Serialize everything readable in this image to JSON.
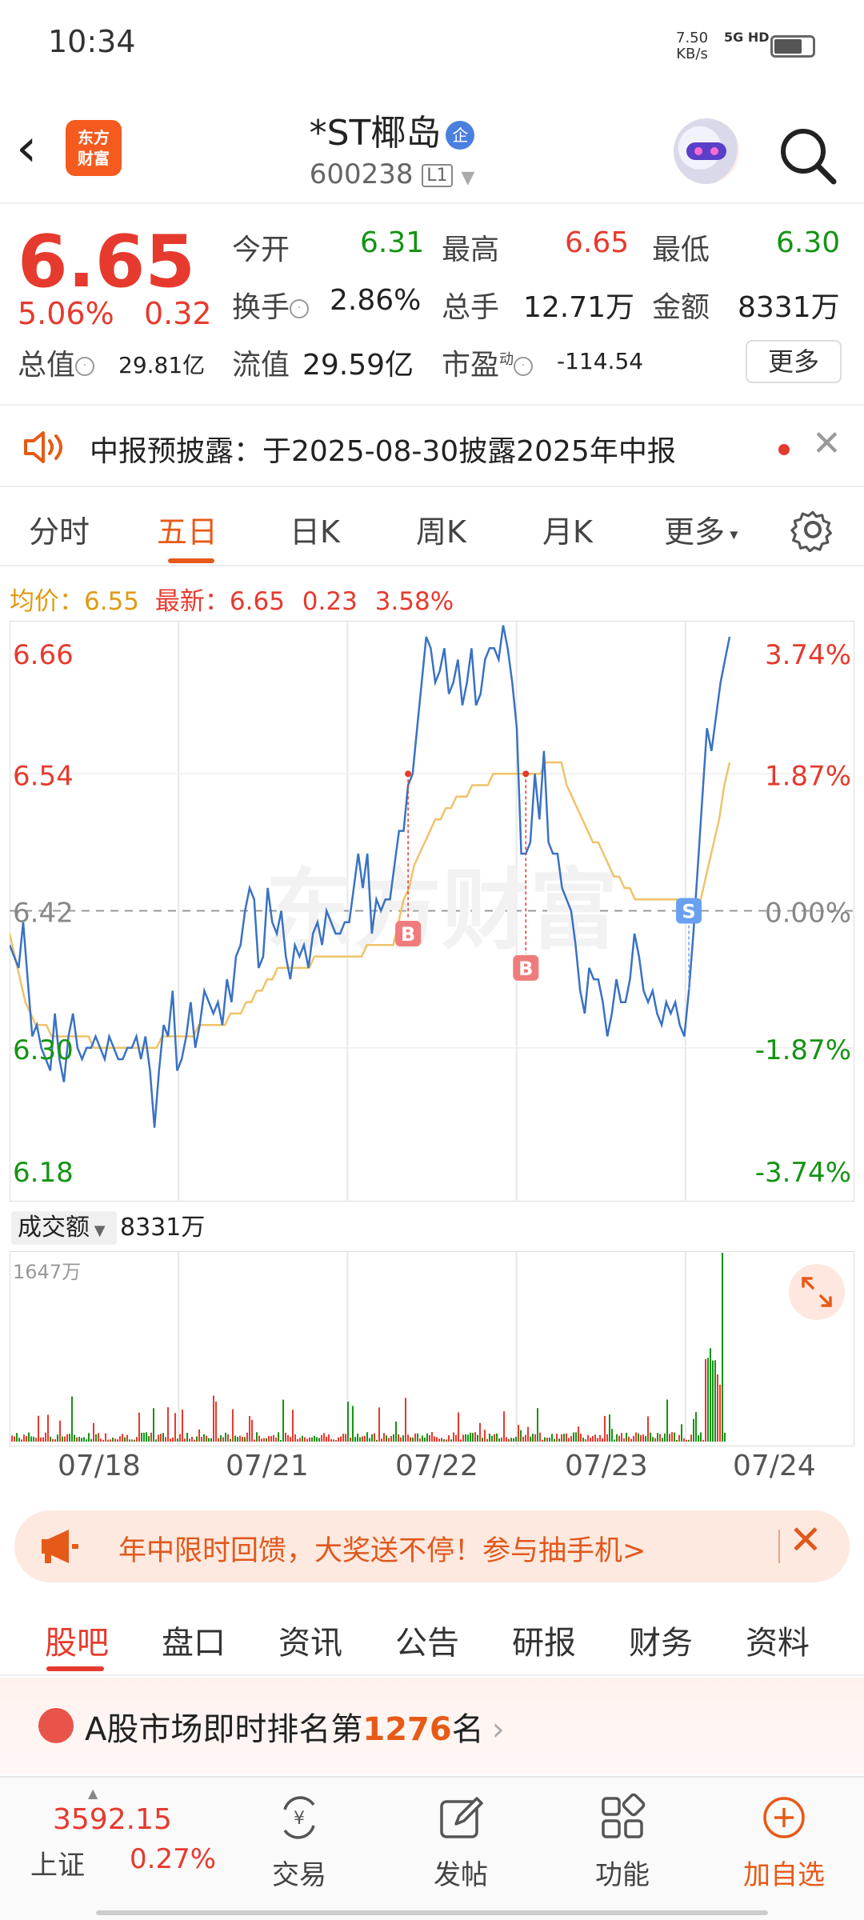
{
  "status_bar": {
    "time": "10:34",
    "net_speed": "7.50",
    "net_unit": "KB/s",
    "signal": "5G HD"
  },
  "header": {
    "logo_line1": "东方",
    "logo_line2": "财富",
    "stock_name": "*ST椰岛",
    "cert_badge": "企",
    "stock_code": "600238",
    "level": "L1"
  },
  "quote": {
    "price": "6.65",
    "change_pct": "5.06%",
    "change_val": "0.32",
    "open_label": "今开",
    "open": "6.31",
    "high_label": "最高",
    "high": "6.65",
    "low_label": "最低",
    "low": "6.30",
    "turnover_label": "换手",
    "turnover": "2.86%",
    "volume_label": "总手",
    "volume": "12.71万",
    "amount_label": "金额",
    "amount": "8331万",
    "mktcap_label": "总值",
    "mktcap": "29.81亿",
    "float_label": "流值",
    "float_cap": "29.59亿",
    "pe_label": "市盈",
    "pe_sup": "动",
    "pe": "-114.54",
    "more_label": "更多"
  },
  "notice": {
    "text": "中报预披露：于2025-08-30披露2025年中报"
  },
  "chart_tabs": [
    {
      "label": "分时"
    },
    {
      "label": "五日"
    },
    {
      "label": "日K"
    },
    {
      "label": "周K"
    },
    {
      "label": "月K"
    },
    {
      "label": "更多"
    }
  ],
  "price_line": {
    "avg_label": "均价：",
    "avg": "6.55",
    "latest_label": "最新：",
    "latest": "6.65",
    "latest_change": "0.23",
    "latest_pct": "3.58%"
  },
  "colors": {
    "up": "#e63a2e",
    "down": "#149414",
    "price_line": "#3a72c4",
    "avg_line": "#efc36a",
    "accent": "#e65a17"
  },
  "chart_data": {
    "type": "line",
    "y_left_ticks": [
      "6.66",
      "6.54",
      "6.42",
      "6.30",
      "6.18"
    ],
    "y_right_ticks": [
      "3.74%",
      "1.87%",
      "0.00%",
      "-1.87%",
      "-3.74%"
    ],
    "ylim": [
      6.18,
      6.66
    ],
    "x_dates": [
      "07/18",
      "07/21",
      "07/22",
      "07/23",
      "07/24"
    ],
    "series": [
      {
        "values": [
          6.39,
          6.38,
          6.37,
          6.41,
          6.36,
          6.31,
          6.32,
          6.3,
          6.29,
          6.28,
          6.33,
          6.29,
          6.27,
          6.31,
          6.33,
          6.3,
          6.29,
          6.3,
          6.3,
          6.31,
          6.3,
          6.29,
          6.31,
          6.3,
          6.29,
          6.29,
          6.3,
          6.3,
          6.31,
          6.29,
          6.31,
          6.28,
          6.23,
          6.28,
          6.32,
          6.31,
          6.35,
          6.28,
          6.29,
          6.31,
          6.34,
          6.3,
          6.32,
          6.35,
          6.34,
          6.33,
          6.34,
          6.32,
          6.36,
          6.34,
          6.38,
          6.39,
          6.42,
          6.44,
          6.43,
          6.37,
          6.38,
          6.44,
          6.41,
          6.4,
          6.42,
          6.38,
          6.36,
          6.39,
          6.38,
          6.39,
          6.37,
          6.4,
          6.41,
          6.39,
          6.42,
          6.41,
          6.4,
          6.4,
          6.41,
          6.41,
          6.44,
          6.47,
          6.44,
          6.47,
          6.4,
          6.43,
          6.42,
          6.43,
          6.43,
          6.46,
          6.49,
          6.49,
          6.53,
          6.54,
          6.58,
          6.62,
          6.66,
          6.65,
          6.62,
          6.63,
          6.65,
          6.61,
          6.62,
          6.64,
          6.6,
          6.62,
          6.65,
          6.6,
          6.61,
          6.64,
          6.65,
          6.65,
          6.64,
          6.67,
          6.65,
          6.62,
          6.58,
          6.47,
          6.47,
          6.48,
          6.54,
          6.5,
          6.56,
          6.48,
          6.47,
          6.47,
          6.44,
          6.43,
          6.42,
          6.39,
          6.35,
          6.33,
          6.37,
          6.36,
          6.36,
          6.34,
          6.31,
          6.33,
          6.36,
          6.34,
          6.34,
          6.36,
          6.4,
          6.38,
          6.35,
          6.34,
          6.35,
          6.33,
          6.32,
          6.34,
          6.33,
          6.34,
          6.32,
          6.31,
          6.35,
          6.4,
          6.46,
          6.52,
          6.58,
          6.56,
          6.59,
          6.62,
          6.64,
          6.66
        ]
      },
      {
        "values": [
          6.4,
          6.38,
          6.36,
          6.34,
          6.33,
          6.32,
          6.32,
          6.32,
          6.31,
          6.31,
          6.31,
          6.31,
          6.31,
          6.31,
          6.31,
          6.31,
          6.3,
          6.3,
          6.3,
          6.3,
          6.3,
          6.3,
          6.3,
          6.3,
          6.3,
          6.3,
          6.3,
          6.3,
          6.3,
          6.31,
          6.31,
          6.31,
          6.31,
          6.31,
          6.31,
          6.31,
          6.32,
          6.32,
          6.32,
          6.32,
          6.32,
          6.32,
          6.33,
          6.33,
          6.33,
          6.34,
          6.34,
          6.35,
          6.35,
          6.36,
          6.36,
          6.37,
          6.37,
          6.37,
          6.37,
          6.37,
          6.37,
          6.37,
          6.38,
          6.38,
          6.38,
          6.38,
          6.38,
          6.38,
          6.38,
          6.38,
          6.38,
          6.38,
          6.39,
          6.39,
          6.39,
          6.39,
          6.39,
          6.39,
          6.41,
          6.43,
          6.44,
          6.46,
          6.47,
          6.48,
          6.49,
          6.5,
          6.5,
          6.51,
          6.51,
          6.52,
          6.52,
          6.52,
          6.53,
          6.53,
          6.53,
          6.53,
          6.54,
          6.54,
          6.54,
          6.54,
          6.54,
          6.54,
          6.54,
          6.54,
          6.54,
          6.54,
          6.55,
          6.55,
          6.55,
          6.55,
          6.53,
          6.52,
          6.51,
          6.5,
          6.49,
          6.48,
          6.48,
          6.47,
          6.46,
          6.45,
          6.45,
          6.44,
          6.44,
          6.43,
          6.43,
          6.43,
          6.43,
          6.43,
          6.43,
          6.43,
          6.43,
          6.43,
          6.42,
          6.42,
          6.41,
          6.42,
          6.44,
          6.46,
          6.48,
          6.5,
          6.53,
          6.55
        ]
      }
    ],
    "markers": [
      {
        "label": "B",
        "type": "buy"
      },
      {
        "label": "B",
        "type": "buy"
      },
      {
        "label": "S",
        "type": "sell"
      }
    ],
    "volume": {
      "label": "成交额",
      "total": "8331万",
      "max_label": "1647万"
    }
  },
  "promo": {
    "text": "年中限时回馈，大奖送不停！参与抽手机>"
  },
  "section_tabs": [
    {
      "label": "股吧"
    },
    {
      "label": "盘口"
    },
    {
      "label": "资讯"
    },
    {
      "label": "公告"
    },
    {
      "label": "研报"
    },
    {
      "label": "财务"
    },
    {
      "label": "资料"
    }
  ],
  "ranking": {
    "prefix": "A股市场即时排名第",
    "rank": "1276",
    "suffix": "名"
  },
  "bottom_nav": {
    "index_value": "3592.15",
    "index_name": "上证",
    "index_change": "0.27%",
    "items": [
      {
        "label": "交易",
        "icon": "trade-icon"
      },
      {
        "label": "发帖",
        "icon": "post-icon"
      },
      {
        "label": "功能",
        "icon": "grid-icon"
      },
      {
        "label": "加自选",
        "icon": "add-favorite-icon"
      }
    ]
  }
}
